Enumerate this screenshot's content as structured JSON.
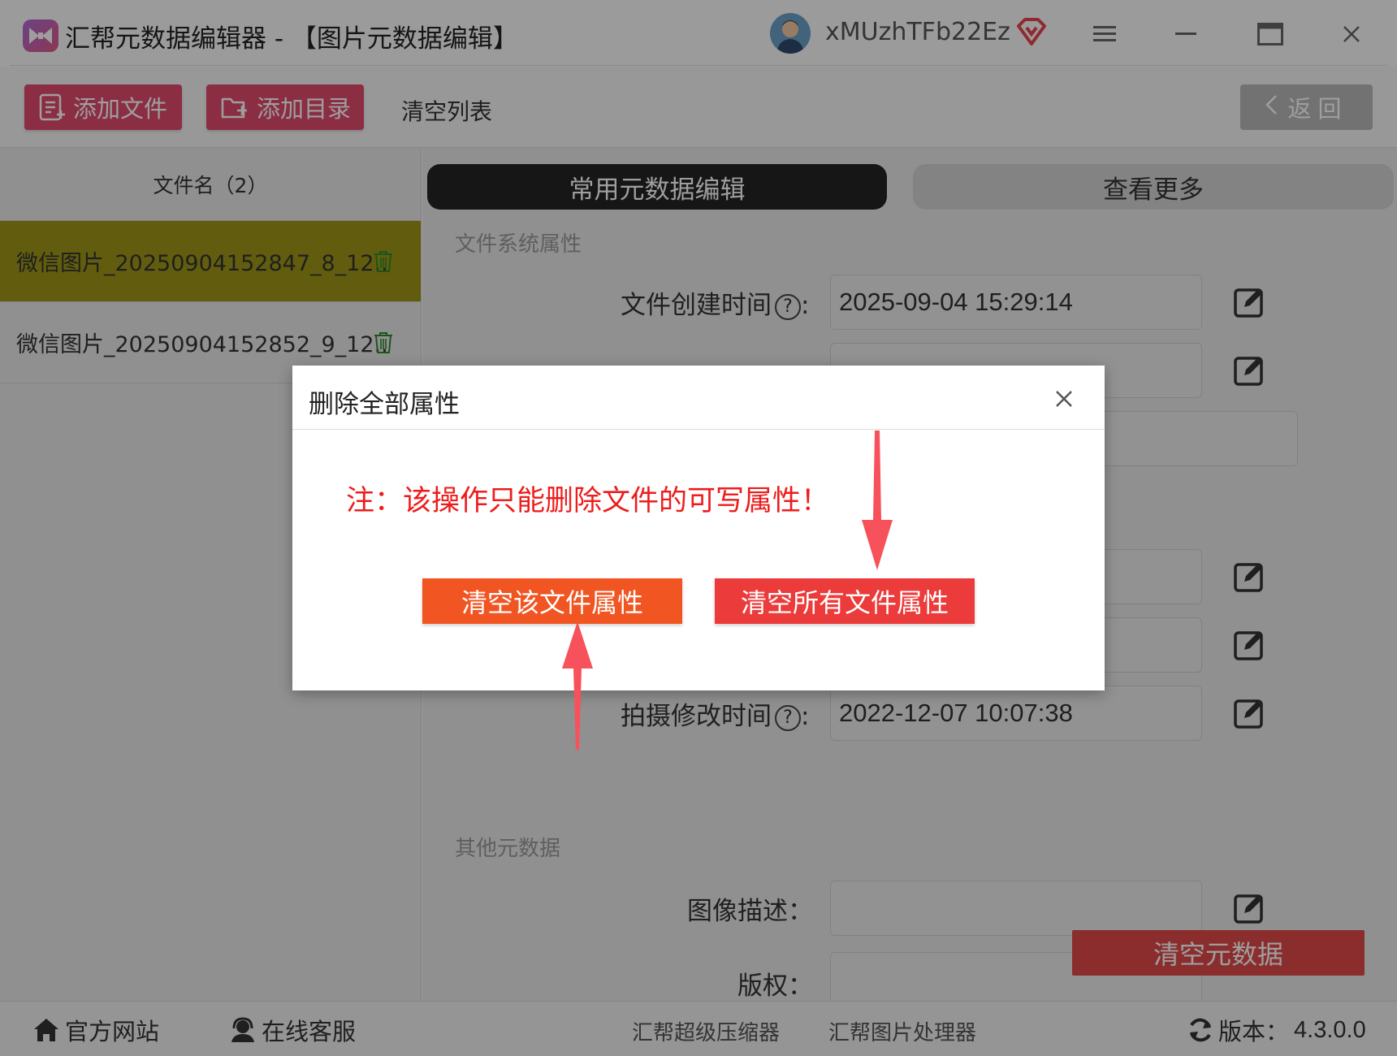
{
  "window": {
    "title": "汇帮元数据编辑器 - 【图片元数据编辑】",
    "username": "xMUzhTFb22Ez"
  },
  "toolbar": {
    "add_file": "添加文件",
    "add_folder": "添加目录",
    "clear_list": "清空列表",
    "back": "返回"
  },
  "sidebar": {
    "header": "文件名（2）",
    "files": [
      "微信图片_20250904152847_8_12..",
      "微信图片_20250904152852_9_12.."
    ]
  },
  "tabs": {
    "common": "常用元数据编辑",
    "more": "查看更多"
  },
  "sections": {
    "fs": "文件系统属性",
    "other": "其他元数据"
  },
  "fields": {
    "created_label": "文件创建时间",
    "created_value": "2025-09-04 15:29:14",
    "shot_modified_label": "拍摄修改时间",
    "shot_modified_value": "2022-12-07 10:07:38",
    "description_label": "图像描述：",
    "copyright_label": "版权："
  },
  "clear_metadata": "清空元数据",
  "footer": {
    "website": "官方网站",
    "support": "在线客服",
    "compressor": "汇帮超级压缩器",
    "image_tool": "汇帮图片处理器",
    "version_label": "版本：",
    "version": "4.3.0.0"
  },
  "dialog": {
    "title": "删除全部属性",
    "note": "注：该操作只能删除文件的可写属性！",
    "clear_this": "清空该文件属性",
    "clear_all": "清空所有文件属性"
  },
  "colors": {
    "accent_pink": "#e14a6c",
    "selected_row": "#9e9718",
    "note_red": "#ee1c1c",
    "btn_orange": "#f05522",
    "btn_red": "#ec3b3b",
    "arrow_red": "#f7515b"
  }
}
